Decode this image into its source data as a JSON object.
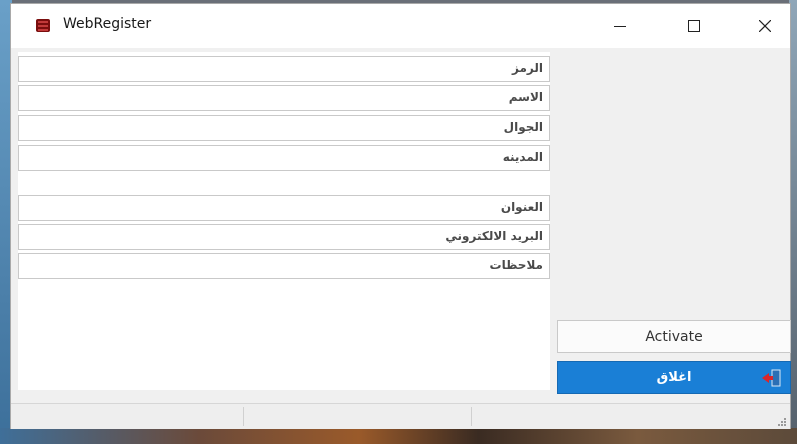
{
  "window": {
    "title": "WebRegister",
    "app_icon": "books-icon",
    "controls": {
      "minimize": "minimize-icon",
      "maximize": "maximize-icon",
      "close": "close-icon"
    }
  },
  "form": {
    "fields": [
      {
        "label": "الرمز"
      },
      {
        "label": "الاسم"
      },
      {
        "label": "الجوال"
      },
      {
        "label": "المدينه"
      },
      {
        "label": "العنوان"
      },
      {
        "label": "البريد الالكتروني"
      },
      {
        "label": "ملاحظات"
      }
    ]
  },
  "actions": {
    "activate_label": "Activate",
    "close_label": "اغلاق",
    "close_icon": "exit-door-icon",
    "close_color": "#1a7fd6"
  },
  "statusbar": {
    "panels": [
      "",
      "",
      ""
    ]
  }
}
